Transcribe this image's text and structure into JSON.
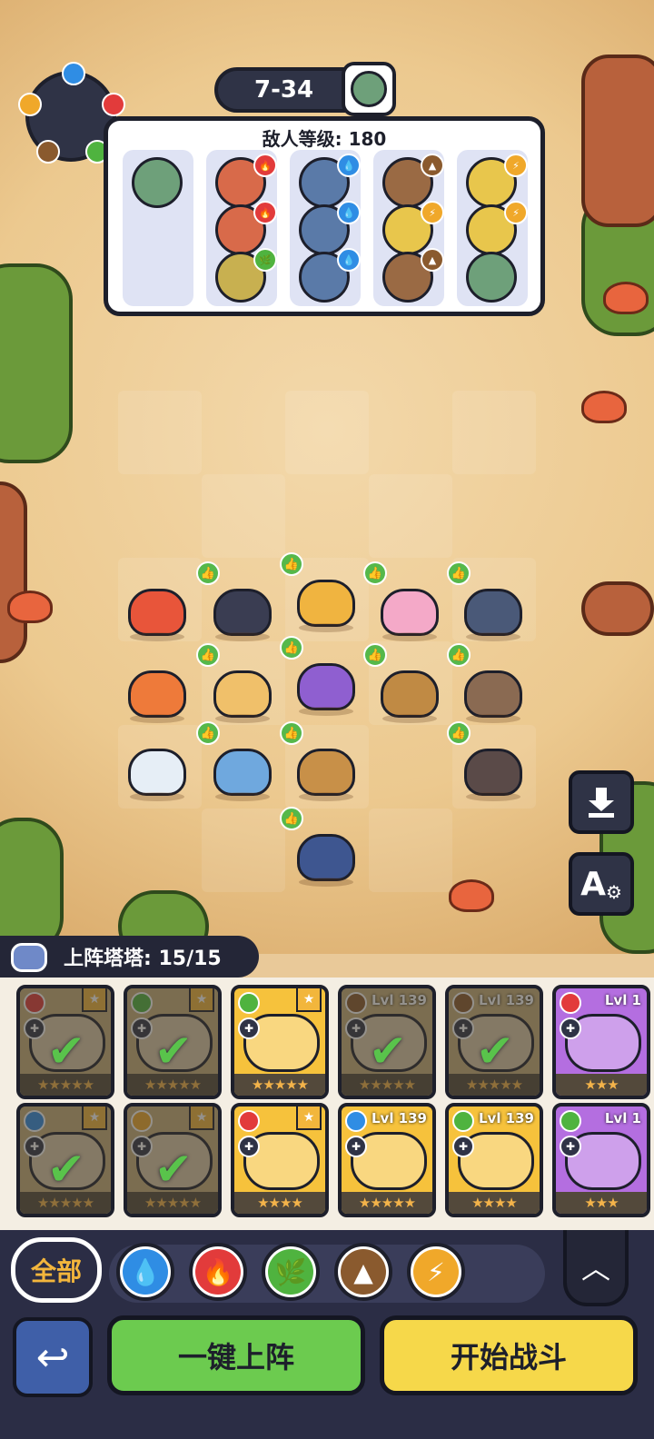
{
  "stage": {
    "level": "7-34",
    "boss_icon": "zombie-boss-icon"
  },
  "enemy_panel": {
    "title": "敌人等级: 180",
    "columns": [
      {
        "enemies": [
          {
            "icon": "green-zombie",
            "element": ""
          }
        ]
      },
      {
        "enemies": [
          {
            "icon": "red-zombie",
            "element": "fire"
          },
          {
            "icon": "red-zombie",
            "element": "fire"
          },
          {
            "icon": "yellow-ghoul",
            "element": "grass"
          }
        ]
      },
      {
        "enemies": [
          {
            "icon": "blue-zombie",
            "element": "water"
          },
          {
            "icon": "blue-zombie",
            "element": "water"
          },
          {
            "icon": "blue-zombie",
            "element": "water"
          }
        ]
      },
      {
        "enemies": [
          {
            "icon": "brown-zombie",
            "element": "earth"
          },
          {
            "icon": "yellow-zombie",
            "element": "thunder"
          },
          {
            "icon": "brown-zombie",
            "element": "earth"
          }
        ]
      },
      {
        "enemies": [
          {
            "icon": "yellow-zombie",
            "element": "thunder"
          },
          {
            "icon": "yellow-zombie",
            "element": "thunder"
          },
          {
            "icon": "green-zombie",
            "element": ""
          }
        ]
      }
    ]
  },
  "element_colors": {
    "water": "#2f8de4",
    "fire": "#e23b3b",
    "grass": "#4fb33f",
    "earth": "#8a5a2e",
    "thunder": "#f0a82a"
  },
  "board_units": [
    {
      "name": "fire-salamander",
      "color": "#e8553a",
      "boost": false
    },
    {
      "name": "black-dog",
      "color": "#3a3d52",
      "boost": true
    },
    {
      "name": "lion",
      "color": "#f0b440",
      "boost": true
    },
    {
      "name": "pink-axolotl",
      "color": "#f4a9c8",
      "boost": true
    },
    {
      "name": "dark-lizard",
      "color": "#4a5978",
      "boost": true
    },
    {
      "name": "tiger",
      "color": "#ee7a3a",
      "boost": false
    },
    {
      "name": "fire-rabbit",
      "color": "#f0c06a",
      "boost": true
    },
    {
      "name": "purple-witch",
      "color": "#8f5fd0",
      "boost": true
    },
    {
      "name": "turtle",
      "color": "#c08a44",
      "boost": true
    },
    {
      "name": "monkey",
      "color": "#8a6a52",
      "boost": true
    },
    {
      "name": "cloud-penguin",
      "color": "#e6eef6",
      "boost": false
    },
    {
      "name": "ice-walrus",
      "color": "#6fa8de",
      "boost": true
    },
    {
      "name": "cage-bear",
      "color": "#c89048",
      "boost": true
    },
    {
      "name": "boar",
      "color": "#5a4a48",
      "boost": true
    },
    {
      "name": "armored-dragon",
      "color": "#3e5690",
      "boost": true
    }
  ],
  "side_buttons": {
    "save_icon": "download-icon",
    "auto_icon": "auto-settings-icon",
    "auto_label": "A"
  },
  "roster": {
    "header": "上阵塔塔: 15/15",
    "cards": [
      {
        "element": "fire",
        "bg": "#c8b07a",
        "lvl": "",
        "selected": true,
        "stars": "★★★★★"
      },
      {
        "element": "grass",
        "bg": "#c8b07a",
        "lvl": "",
        "selected": true,
        "stars": "★★★★★"
      },
      {
        "element": "grass",
        "bg": "#f6c23c",
        "lvl": "",
        "selected": false,
        "stars": "★★★★★"
      },
      {
        "element": "earth",
        "bg": "#c8b07a",
        "lvl": "Lvl 139",
        "selected": true,
        "stars": "★★★★★"
      },
      {
        "element": "earth",
        "bg": "#c8b07a",
        "lvl": "Lvl 139",
        "selected": true,
        "stars": "★★★★★"
      },
      {
        "element": "fire",
        "bg": "#b46ee0",
        "lvl": "Lvl 1",
        "selected": false,
        "stars": "★★★"
      },
      {
        "element": "water",
        "bg": "#c8b07a",
        "lvl": "",
        "selected": true,
        "stars": "★★★★★"
      },
      {
        "element": "thunder",
        "bg": "#c8b07a",
        "lvl": "",
        "selected": true,
        "stars": "★★★★★"
      },
      {
        "element": "fire",
        "bg": "#f6c23c",
        "lvl": "",
        "selected": false,
        "stars": "★★★★"
      },
      {
        "element": "water",
        "bg": "#f6c23c",
        "lvl": "Lvl 139",
        "selected": false,
        "stars": "★★★★★"
      },
      {
        "element": "grass",
        "bg": "#f6c23c",
        "lvl": "Lvl 139",
        "selected": false,
        "stars": "★★★★"
      },
      {
        "element": "grass",
        "bg": "#b46ee0",
        "lvl": "Lvl 1",
        "selected": false,
        "stars": "★★★"
      }
    ]
  },
  "filters": {
    "all_label": "全部",
    "items": [
      {
        "name": "water",
        "symbol": "💧"
      },
      {
        "name": "fire",
        "symbol": "🔥"
      },
      {
        "name": "grass",
        "symbol": "🌿"
      },
      {
        "name": "earth",
        "symbol": "▲"
      },
      {
        "name": "thunder",
        "symbol": "⚡"
      }
    ],
    "collapse_icon": "chevron-up-icon"
  },
  "bottom": {
    "back_icon": "return-arrow-icon",
    "deploy_label": "一键上阵",
    "start_label": "开始战斗"
  }
}
